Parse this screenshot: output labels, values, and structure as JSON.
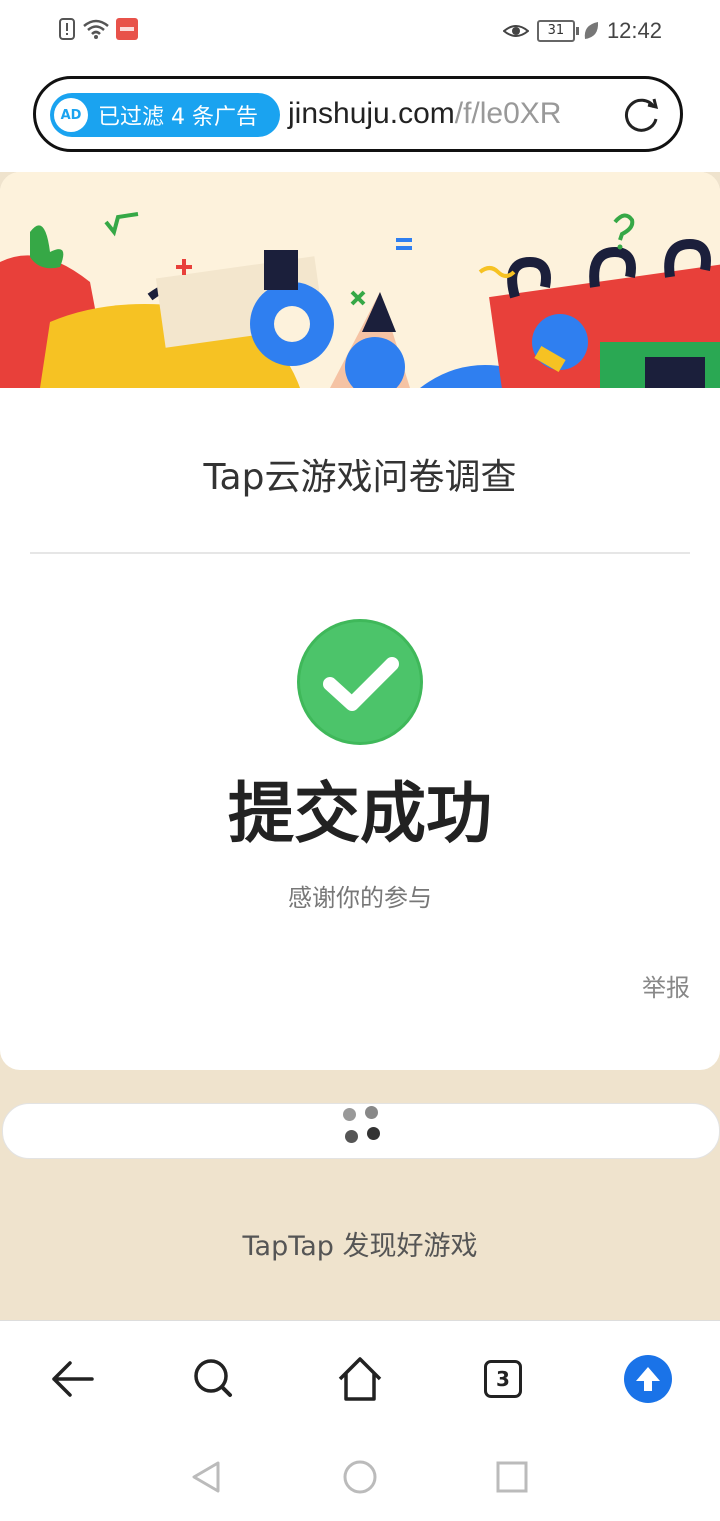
{
  "status_bar": {
    "time": "12:42",
    "battery": "31",
    "icons": [
      "alert-icon",
      "wifi-icon",
      "app-notification-icon",
      "eye-icon",
      "battery-icon",
      "leaf-icon"
    ]
  },
  "address_bar": {
    "ad_filter_label": "已过滤 4 条广告",
    "ad_icon_text": "AD",
    "url_domain": "jinshuju.com",
    "url_path": "/f/le0XR"
  },
  "form": {
    "title": "Tap云游戏问卷调查",
    "success_title": "提交成功",
    "thanks_text": "感谢你的参与",
    "report_link": "举报"
  },
  "footer": {
    "text": "TapTap 发现好游戏"
  },
  "toolbar": {
    "tab_count": "3",
    "accent_color": "#1a73e8"
  },
  "colors": {
    "success_green": "#4cc46a",
    "ad_pill_blue": "#1aa3f0",
    "page_background": "#efe3cd"
  }
}
